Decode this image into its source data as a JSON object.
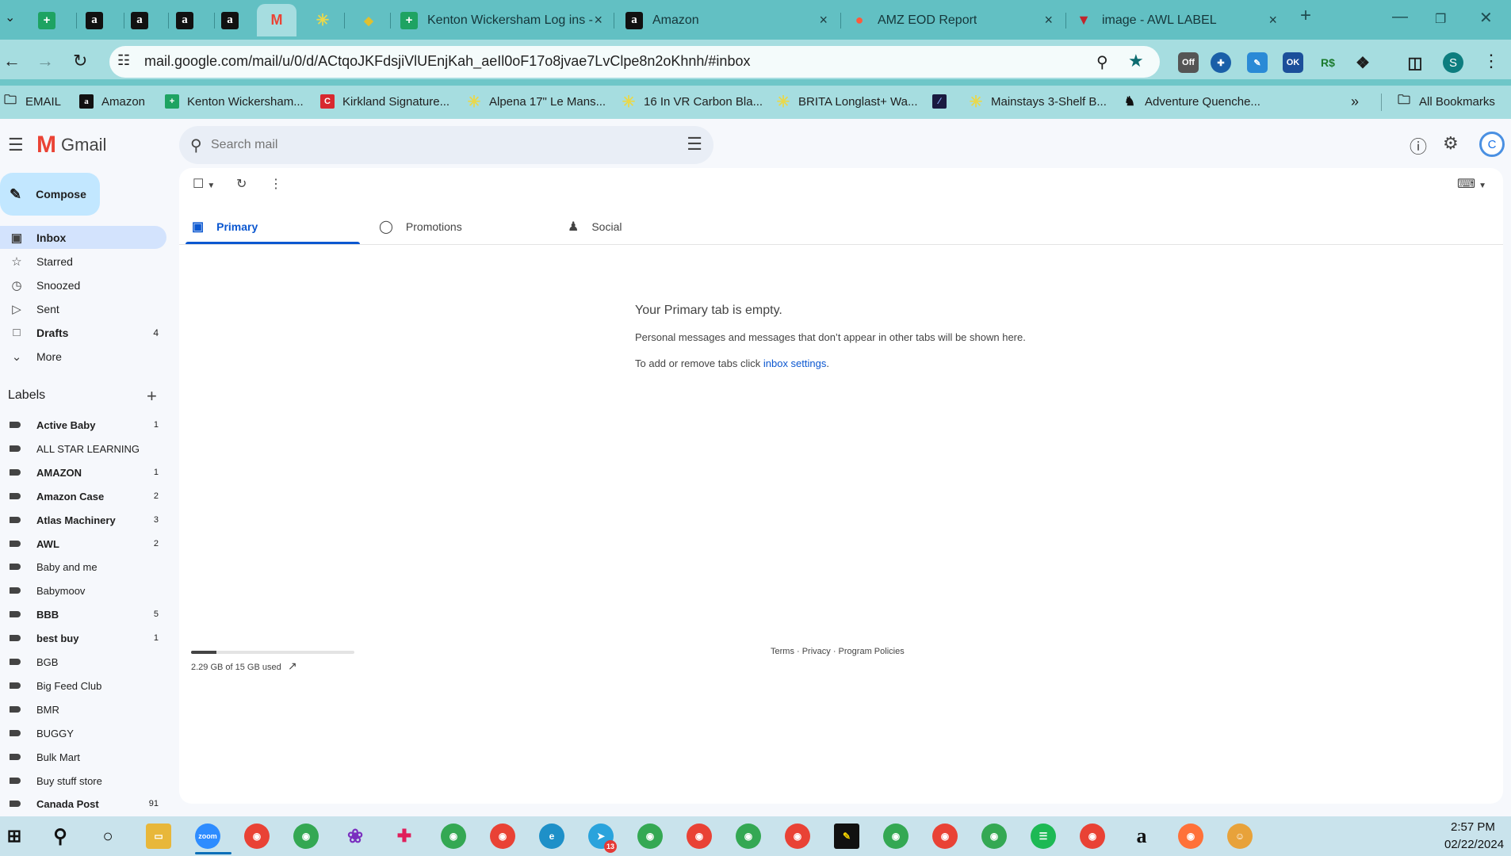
{
  "browser": {
    "tabs": [
      {
        "title": "",
        "icon": "sheets-icon"
      },
      {
        "title": "",
        "icon": "amazon-icon"
      },
      {
        "title": "",
        "icon": "amazon-icon"
      },
      {
        "title": "",
        "icon": "amazon-icon"
      },
      {
        "title": "",
        "icon": "amazon-icon"
      },
      {
        "title": "",
        "icon": "gmail-icon",
        "active": true
      },
      {
        "title": "",
        "icon": "walmart-icon"
      },
      {
        "title": "",
        "icon": "app-icon"
      },
      {
        "title": "Kenton Wickersham Log ins -",
        "icon": "sheets-icon"
      },
      {
        "title": "Amazon",
        "icon": "amazon-icon"
      },
      {
        "title": "AMZ EOD Report",
        "icon": "monday-icon"
      },
      {
        "title": "image - AWL LABEL",
        "icon": "app-icon"
      }
    ],
    "url": "mail.google.com/mail/u/0/d/ACtqoJKFdsjiVlUEnjKah_aeIl0oF17o8jvae7LvClpe8n2oKhnh/#inbox",
    "profile_initial": "S",
    "bookmarks": [
      "EMAIL",
      "Amazon",
      "Kenton Wickersham...",
      "Kirkland Signature...",
      "Alpena 17\" Le Mans...",
      "16 In VR Carbon Bla...",
      "BRITA Longlast+ Wa...",
      "",
      "Mainstays 3-Shelf B...",
      "Adventure Quenche..."
    ],
    "all_bookmarks": "All Bookmarks"
  },
  "gmail": {
    "product_name": "Gmail",
    "search_placeholder": "Search mail",
    "account_initial": "C",
    "compose_label": "Compose",
    "nav": [
      {
        "label": "Inbox",
        "count": "",
        "icon": "inbox-icon",
        "active": true
      },
      {
        "label": "Starred",
        "count": "",
        "icon": "star-icon"
      },
      {
        "label": "Snoozed",
        "count": "",
        "icon": "clock-icon"
      },
      {
        "label": "Sent",
        "count": "",
        "icon": "send-icon"
      },
      {
        "label": "Drafts",
        "count": "4",
        "icon": "draft-icon",
        "bold": true
      },
      {
        "label": "More",
        "count": "",
        "icon": "chevron-down-icon"
      }
    ],
    "labels_title": "Labels",
    "labels": [
      {
        "name": "Active Baby",
        "count": "1",
        "bold": true
      },
      {
        "name": "ALL STAR LEARNING",
        "count": ""
      },
      {
        "name": "AMAZON",
        "count": "1",
        "bold": true
      },
      {
        "name": "Amazon Case",
        "count": "2",
        "bold": true
      },
      {
        "name": "Atlas Machinery",
        "count": "3",
        "bold": true
      },
      {
        "name": "AWL",
        "count": "2",
        "bold": true
      },
      {
        "name": "Baby and me",
        "count": ""
      },
      {
        "name": "Babymoov",
        "count": ""
      },
      {
        "name": "BBB",
        "count": "5",
        "bold": true
      },
      {
        "name": "best buy",
        "count": "1",
        "bold": true
      },
      {
        "name": "BGB",
        "count": ""
      },
      {
        "name": "Big Feed Club",
        "count": ""
      },
      {
        "name": "BMR",
        "count": ""
      },
      {
        "name": "BUGGY",
        "count": ""
      },
      {
        "name": "Bulk Mart",
        "count": ""
      },
      {
        "name": "Buy stuff store",
        "count": ""
      },
      {
        "name": "Canada Post",
        "count": "91",
        "bold": true
      }
    ],
    "tabs": [
      {
        "label": "Primary",
        "icon": "inbox-icon",
        "active": true
      },
      {
        "label": "Promotions",
        "icon": "tag-icon"
      },
      {
        "label": "Social",
        "icon": "people-icon"
      }
    ],
    "empty": {
      "title": "Your Primary tab is empty.",
      "description": "Personal messages and messages that don’t appear in other tabs will be shown here.",
      "hint_prefix": "To add or remove tabs click ",
      "hint_link": "inbox settings",
      "hint_suffix": "."
    },
    "storage": {
      "text": "2.29 GB of 15 GB used",
      "fraction": 0.153
    },
    "footer": "Terms · Privacy · Program Policies"
  },
  "taskbar": {
    "time": "2:57 PM",
    "date": "02/22/2024",
    "telegram_badge": "13"
  },
  "colors": {
    "accent": "#0b57d0",
    "compose": "#c2e7ff",
    "active_nav": "#d3e3fd",
    "chrome": "#a6dde0"
  }
}
